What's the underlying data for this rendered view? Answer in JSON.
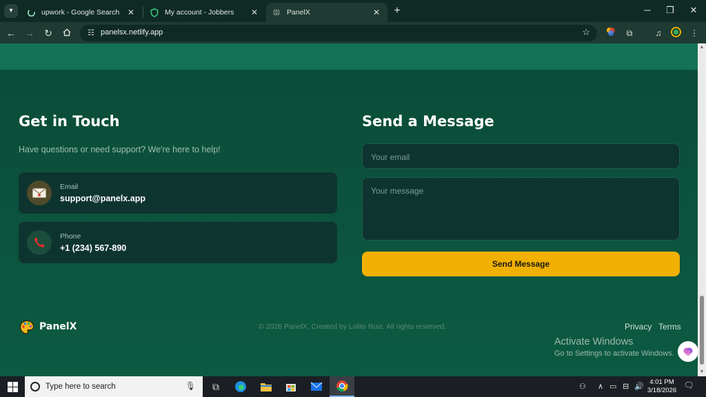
{
  "browser": {
    "tabs": [
      {
        "title": "upwork - Google Search",
        "active": false
      },
      {
        "title": "My account - Jobbers",
        "active": false
      },
      {
        "title": "PanelX",
        "active": true
      }
    ],
    "url": "panelsx.netlify.app"
  },
  "page": {
    "contact": {
      "title": "Get in Touch",
      "subtitle": "Have questions or need support? We're here to help!",
      "cards": [
        {
          "label": "Email",
          "value": "support@panelx.app"
        },
        {
          "label": "Phone",
          "value": "+1 (234) 567-890"
        }
      ]
    },
    "form": {
      "title": "Send a Message",
      "email_placeholder": "Your email",
      "message_placeholder": "Your message",
      "submit_label": "Send Message"
    },
    "footer": {
      "brand": "PanelX",
      "copyright": "© 2026 PanelX. Created by Lolito Ruiz. All rights reserved.",
      "links": [
        "Privacy",
        "Terms"
      ]
    },
    "watermark": {
      "line1": "Activate Windows",
      "line2": "Go to Settings to activate Windows."
    }
  },
  "taskbar": {
    "search_placeholder": "Type here to search",
    "time": "4:01 PM",
    "date": "3/18/2026"
  },
  "colors": {
    "accent": "#f0b103",
    "page_bg": "#0b4a38",
    "card_bg": "#0e3430",
    "band": "#137154"
  }
}
